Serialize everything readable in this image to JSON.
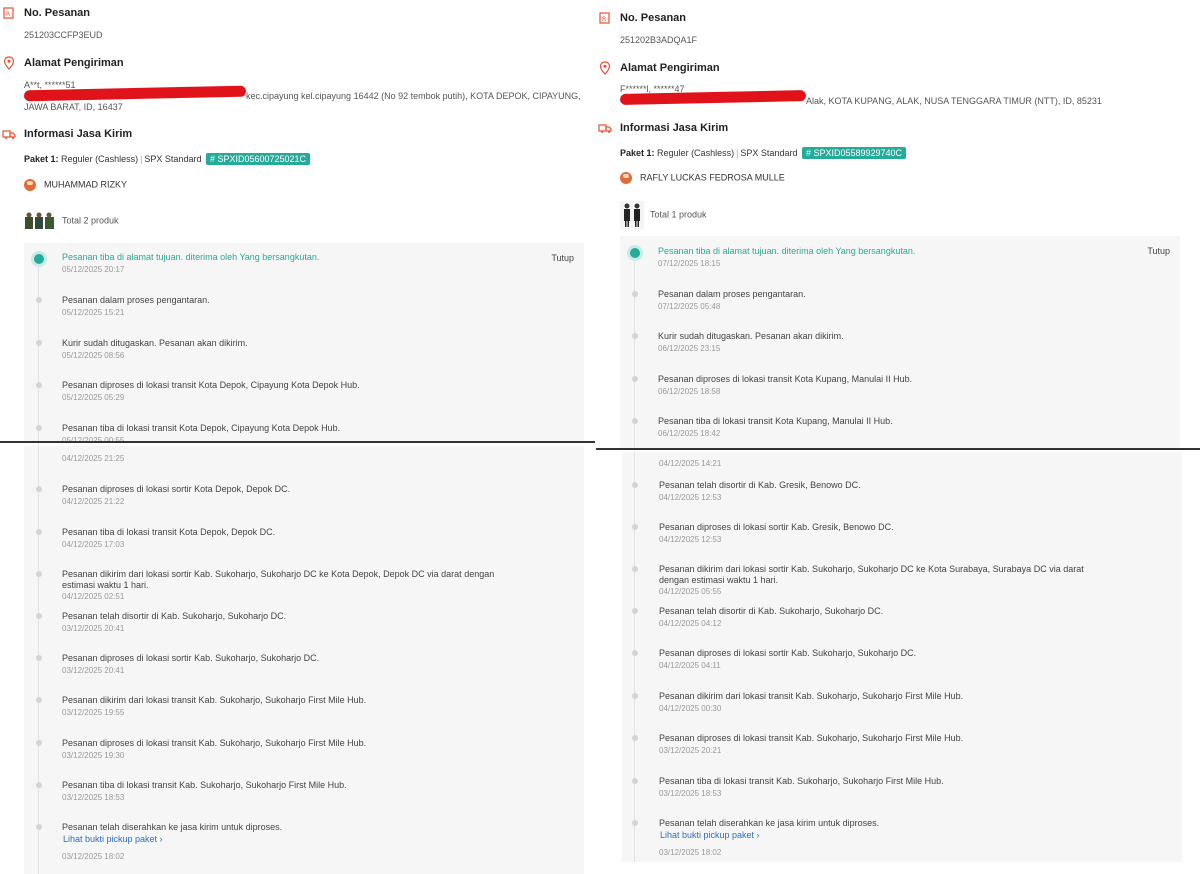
{
  "left": {
    "order_label": "No. Pesanan",
    "order_no": "251203CCFP3EUD",
    "address_label": "Alamat Pengiriman",
    "recipient_masked": "A**t, ******51",
    "address_line1": "kec.cipayung kel.cipayung 16442 (No 92 tembok putih), KOTA DEPOK, CIPAYUNG,",
    "address_line2": "JAWA BARAT, ID, 16437",
    "shipping_label": "Informasi Jasa Kirim",
    "paket_label": "Paket 1:",
    "service": "Reguler (Cashless)",
    "carrier": "SPX Standard",
    "tracking": "# SPXID05600725021C",
    "courier": "MUHAMMAD RIZKY",
    "products": "Total 2 produk",
    "tutup": "Tutup",
    "events_top": [
      {
        "title": "Pesanan tiba di alamat tujuan. diterima oleh Yang bersangkutan.",
        "time": "05/12/2025 20:17"
      },
      {
        "title": "Pesanan dalam proses pengantaran.",
        "time": "05/12/2025 15:21"
      },
      {
        "title": "Kurir sudah ditugaskan. Pesanan akan dikirim.",
        "time": "05/12/2025 08:56"
      },
      {
        "title": "Pesanan diproses di lokasi transit Kota Depok, Cipayung Kota Depok Hub.",
        "time": "05/12/2025 05:29"
      },
      {
        "title": "Pesanan tiba di lokasi transit Kota Depok, Cipayung Kota Depok Hub.",
        "time": "05/12/2025 00:55"
      }
    ],
    "events_bottom_first_time": "04/12/2025 21:25",
    "events_bottom": [
      {
        "title": "Pesanan diproses di lokasi sortir Kota Depok, Depok DC.",
        "time": "04/12/2025 21:22"
      },
      {
        "title": "Pesanan tiba di lokasi transit Kota Depok, Depok DC.",
        "time": "04/12/2025 17:03"
      },
      {
        "title": "Pesanan dikirim dari lokasi sortir Kab. Sukoharjo, Sukoharjo DC ke Kota Depok, Depok DC via darat dengan",
        "title2": "estimasi waktu 1 hari.",
        "time": "04/12/2025 02:51"
      },
      {
        "title": "Pesanan telah disortir di Kab. Sukoharjo, Sukoharjo DC.",
        "time": "03/12/2025 20:41"
      },
      {
        "title": "Pesanan diproses di lokasi sortir Kab. Sukoharjo, Sukoharjo DC.",
        "time": "03/12/2025 20:41"
      },
      {
        "title": "Pesanan dikirim dari lokasi transit Kab. Sukoharjo, Sukoharjo First Mile Hub.",
        "time": "03/12/2025 19:55"
      },
      {
        "title": "Pesanan diproses di lokasi transit Kab. Sukoharjo, Sukoharjo First Mile Hub.",
        "time": "03/12/2025 19:30"
      },
      {
        "title": "Pesanan tiba di lokasi transit Kab. Sukoharjo, Sukoharjo First Mile Hub.",
        "time": "03/12/2025 18:53"
      },
      {
        "title": "Pesanan telah diserahkan ke jasa kirim untuk diproses.",
        "link": "Lihat bukti pickup paket ›",
        "time": "03/12/2025 18:02"
      }
    ]
  },
  "right": {
    "order_label": "No. Pesanan",
    "order_no": "251202B3ADQA1F",
    "address_label": "Alamat Pengiriman",
    "recipient_masked": "F******l, ******47",
    "address_line1": "Alak, KOTA KUPANG, ALAK, NUSA TENGGARA TIMUR (NTT), ID, 85231",
    "shipping_label": "Informasi Jasa Kirim",
    "paket_label": "Paket 1:",
    "service": "Reguler (Cashless)",
    "carrier": "SPX Standard",
    "tracking": "# SPXID05589929740C",
    "courier": "RAFLY LUCKAS FEDROSA MULLE",
    "products": "Total 1 produk",
    "tutup": "Tutup",
    "events_top": [
      {
        "title": "Pesanan tiba di alamat tujuan. diterima oleh Yang bersangkutan.",
        "time": "07/12/2025 18:15"
      },
      {
        "title": "Pesanan dalam proses pengantaran.",
        "time": "07/12/2025 05:48"
      },
      {
        "title": "Kurir sudah ditugaskan. Pesanan akan dikirim.",
        "time": "06/12/2025 23:15"
      },
      {
        "title": "Pesanan diproses di lokasi transit Kota Kupang, Manulai II Hub.",
        "time": "06/12/2025 18:58"
      },
      {
        "title": "Pesanan tiba di lokasi transit Kota Kupang, Manulai II Hub.",
        "time": "06/12/2025 18:42"
      }
    ],
    "events_bottom_first_time": "04/12/2025 14:21",
    "events_bottom": [
      {
        "title": "Pesanan telah disortir di Kab. Gresik, Benowo DC.",
        "time": "04/12/2025 12:53"
      },
      {
        "title": "Pesanan diproses di lokasi sortir Kab. Gresik, Benowo DC.",
        "time": "04/12/2025 12:53"
      },
      {
        "title": "Pesanan dikirim dari lokasi sortir Kab. Sukoharjo, Sukoharjo DC ke Kota Surabaya, Surabaya DC via darat",
        "title2": "dengan estimasi waktu 1 hari.",
        "time": "04/12/2025 05:55"
      },
      {
        "title": "Pesanan telah disortir di Kab. Sukoharjo, Sukoharjo DC.",
        "time": "04/12/2025 04:12"
      },
      {
        "title": "Pesanan diproses di lokasi sortir Kab. Sukoharjo, Sukoharjo DC.",
        "time": "04/12/2025 04:11"
      },
      {
        "title": "Pesanan dikirim dari lokasi transit Kab. Sukoharjo, Sukoharjo First Mile Hub.",
        "time": "04/12/2025 00:30"
      },
      {
        "title": "Pesanan diproses di lokasi transit Kab. Sukoharjo, Sukoharjo First Mile Hub.",
        "time": "03/12/2025 20:21"
      },
      {
        "title": "Pesanan tiba di lokasi transit Kab. Sukoharjo, Sukoharjo First Mile Hub.",
        "time": "03/12/2025 18:53"
      },
      {
        "title": "Pesanan telah diserahkan ke jasa kirim untuk diproses.",
        "link": "Lihat bukti pickup paket ›",
        "time": "03/12/2025 18:02"
      }
    ]
  },
  "colors": {
    "accent": "#26aa99",
    "redaction": "#e0131b",
    "link": "#2b6fc4"
  }
}
